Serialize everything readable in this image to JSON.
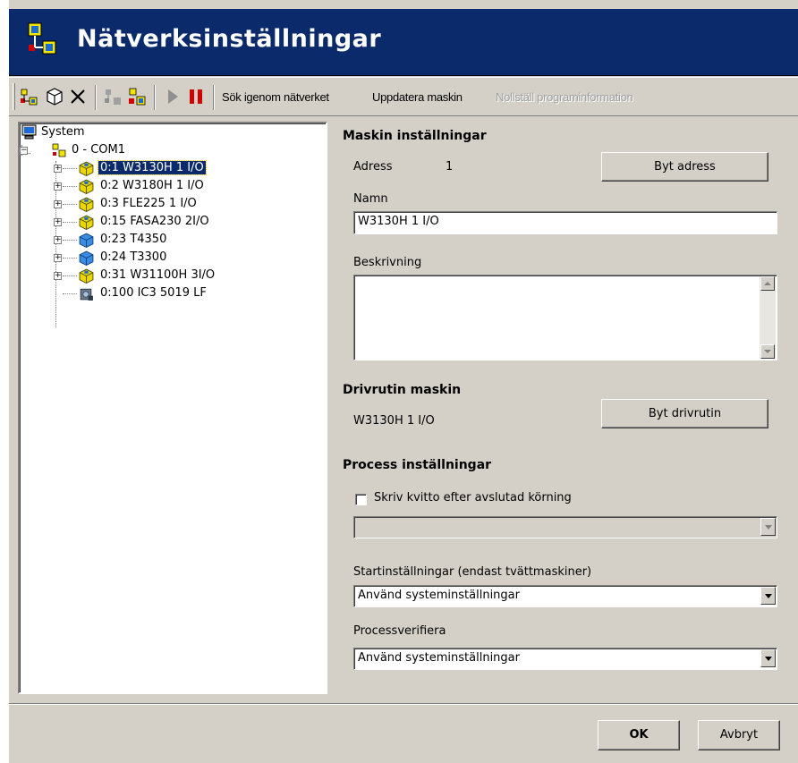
{
  "window": {
    "title": "Nätverksinställningar"
  },
  "toolbar": {
    "icons": [
      "add-machine-icon",
      "package-icon",
      "delete-icon",
      "network-disabled-icon",
      "network-machine-icon",
      "play-icon",
      "pause-icon"
    ],
    "search_label": "Sök igenom nätverket",
    "update_label": "Uppdatera maskin",
    "reset_label": "Nollställ programinformation"
  },
  "tree": {
    "root": "System",
    "port": "0 - COM1",
    "items": [
      {
        "label": "0:1 W3130H 1 I/O",
        "icon": "yellow-cube-icon",
        "selected": true
      },
      {
        "label": "0:2 W3180H 1 I/O",
        "icon": "yellow-cube-icon"
      },
      {
        "label": "0:3 FLE225 1 I/O",
        "icon": "yellow-cube-icon"
      },
      {
        "label": "0:15 FASA230 2I/O",
        "icon": "yellow-cube-icon"
      },
      {
        "label": "0:23 T4350",
        "icon": "blue-cube-icon"
      },
      {
        "label": "0:24 T3300",
        "icon": "blue-cube-icon"
      },
      {
        "label": "0:31 W31100H 3I/O",
        "icon": "yellow-cube-icon"
      },
      {
        "label": "0:100 IC3 5019 LF",
        "icon": "machine-icon"
      }
    ]
  },
  "machine": {
    "section_title": "Maskin inställningar",
    "address_label": "Adress",
    "address_value": "1",
    "change_address_button": "Byt adress",
    "name_label": "Namn",
    "name_value": "W3130H 1 I/O",
    "description_label": "Beskrivning",
    "description_value": ""
  },
  "driver": {
    "section_title": "Drivrutin maskin",
    "driver_value": "W3130H 1 I/O",
    "change_driver_button": "Byt drivrutin"
  },
  "process": {
    "section_title": "Process inställningar",
    "receipt_checkbox_label": "Skriv kvitto efter avslutad körning",
    "receipt_checked": false,
    "receipt_select_value": "",
    "start_label": "Startinställningar (endast tvättmaskiner)",
    "start_value": "Använd systeminställningar",
    "verify_label": "Processverifiera",
    "verify_value": "Använd systeminställningar"
  },
  "footer": {
    "ok_button": "OK",
    "cancel_button": "Avbryt"
  },
  "colors": {
    "titlebar": "#0a2a6b",
    "face": "#d4d0c8",
    "selection": "#0a2a6b",
    "pause_red": "#d00000"
  }
}
